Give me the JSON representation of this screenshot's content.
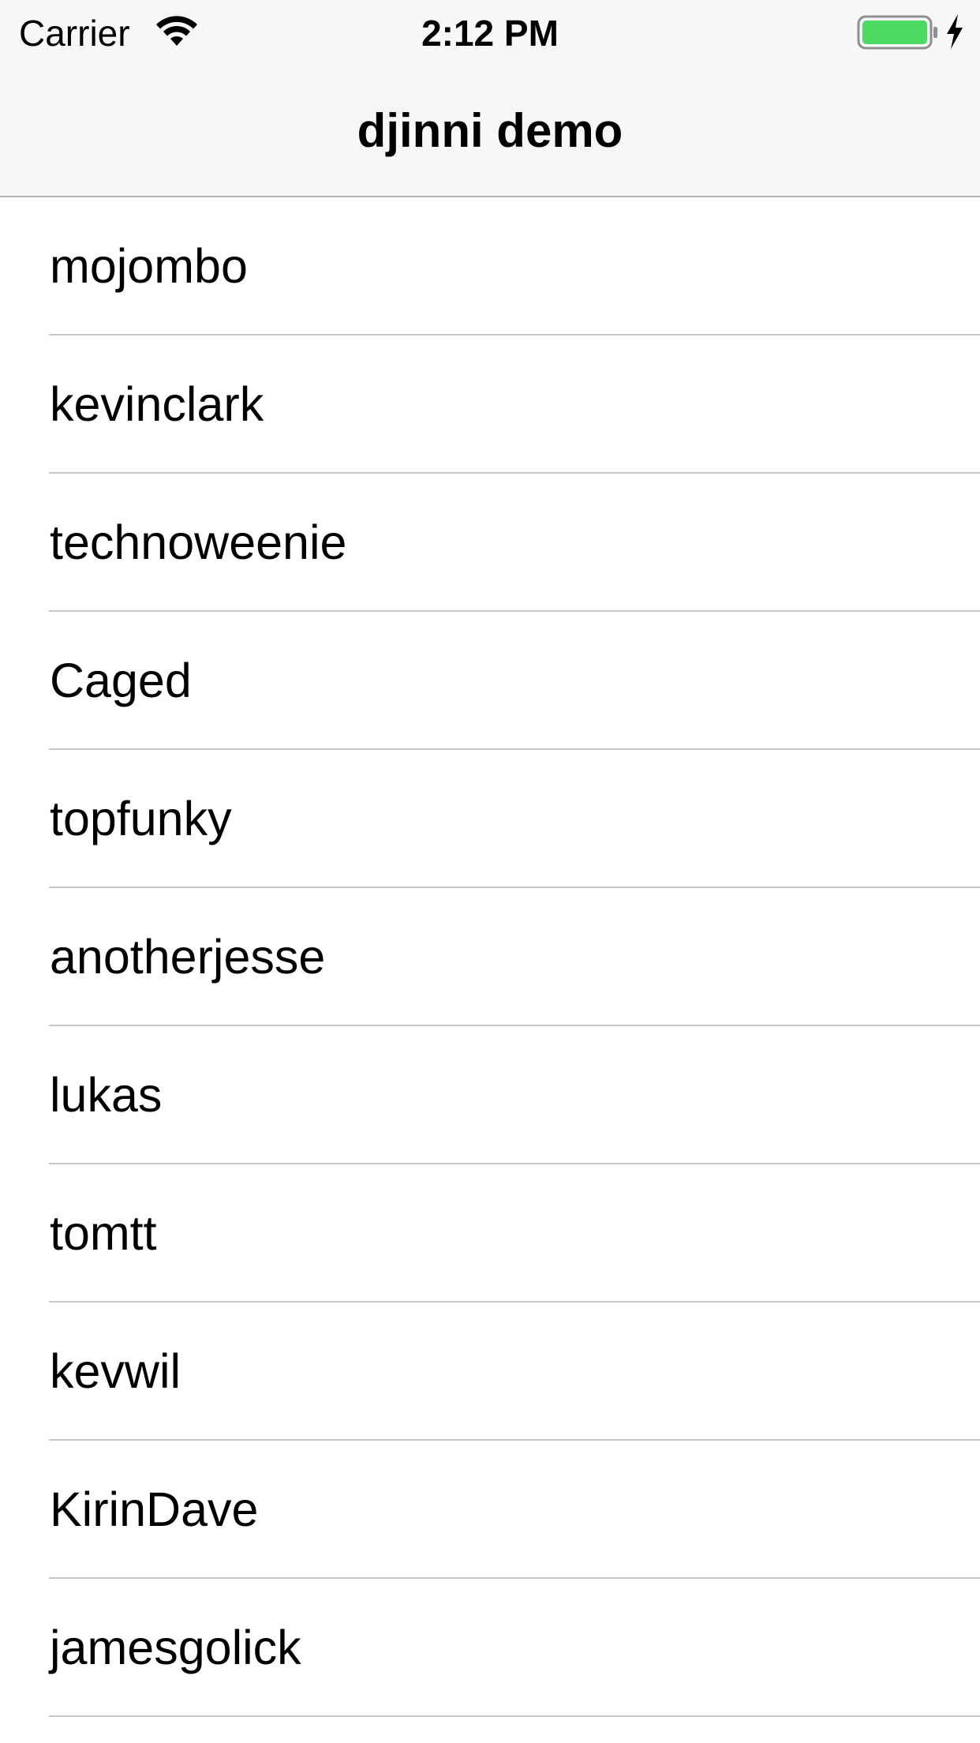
{
  "status_bar": {
    "carrier": "Carrier",
    "time": "2:12 PM",
    "wifi_icon": "wifi-icon",
    "battery_icon": "battery-icon",
    "battery_level": 1.0,
    "battery_color": "#4cd964",
    "charging_icon": "charging-bolt-icon"
  },
  "nav": {
    "title": "djinni demo"
  },
  "list": {
    "items": [
      {
        "label": "mojombo"
      },
      {
        "label": "kevinclark"
      },
      {
        "label": "technoweenie"
      },
      {
        "label": "Caged"
      },
      {
        "label": "topfunky"
      },
      {
        "label": "anotherjesse"
      },
      {
        "label": "lukas"
      },
      {
        "label": "tomtt"
      },
      {
        "label": "kevwil"
      },
      {
        "label": "KirinDave"
      },
      {
        "label": "jamesgolick"
      }
    ]
  }
}
